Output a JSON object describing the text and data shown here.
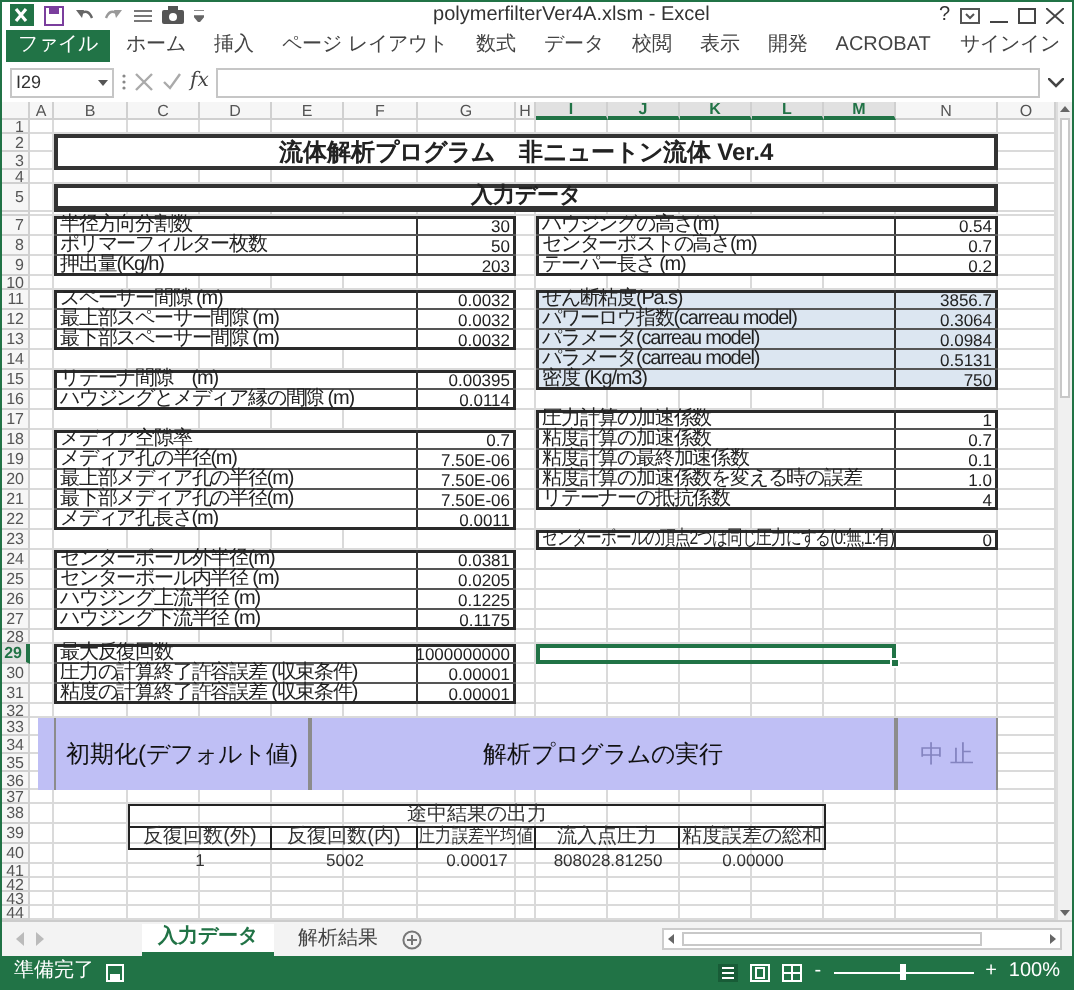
{
  "window": {
    "title": "polymerfilterVer4A.xlsm - Excel",
    "help": "?"
  },
  "ribbon_tabs": [
    {
      "label": "ファイル",
      "selected": true
    },
    {
      "label": "ホーム",
      "selected": false
    },
    {
      "label": "挿入",
      "selected": false
    },
    {
      "label": "ページ レイアウト",
      "selected": false
    },
    {
      "label": "数式",
      "selected": false
    },
    {
      "label": "データ",
      "selected": false
    },
    {
      "label": "校閲",
      "selected": false
    },
    {
      "label": "表示",
      "selected": false
    },
    {
      "label": "開発",
      "selected": false
    },
    {
      "label": "ACROBAT",
      "selected": false
    }
  ],
  "sign_in": "サインイン",
  "formula_bar": {
    "name_box": "I29",
    "function_label": "fx"
  },
  "columns": [
    {
      "label": "A",
      "selected": false
    },
    {
      "label": "B",
      "selected": false
    },
    {
      "label": "C",
      "selected": false
    },
    {
      "label": "D",
      "selected": false
    },
    {
      "label": "E",
      "selected": false
    },
    {
      "label": "F",
      "selected": false
    },
    {
      "label": "G",
      "selected": false
    },
    {
      "label": "H",
      "selected": false
    },
    {
      "label": "I",
      "selected": true
    },
    {
      "label": "J",
      "selected": true
    },
    {
      "label": "K",
      "selected": true
    },
    {
      "label": "L",
      "selected": true
    },
    {
      "label": "M",
      "selected": true
    },
    {
      "label": "N",
      "selected": false
    },
    {
      "label": "O",
      "selected": false
    }
  ],
  "rows": [
    {
      "label": "1",
      "selected": false
    },
    {
      "label": "2",
      "selected": false
    },
    {
      "label": "3",
      "selected": false
    },
    {
      "label": "4",
      "selected": false
    },
    {
      "label": "5",
      "selected": false
    },
    {
      "label": "7",
      "selected": false
    },
    {
      "label": "8",
      "selected": false
    },
    {
      "label": "9",
      "selected": false
    },
    {
      "label": "10",
      "selected": false
    },
    {
      "label": "11",
      "selected": false
    },
    {
      "label": "12",
      "selected": false
    },
    {
      "label": "13",
      "selected": false
    },
    {
      "label": "14",
      "selected": false
    },
    {
      "label": "15",
      "selected": false
    },
    {
      "label": "16",
      "selected": false
    },
    {
      "label": "17",
      "selected": false
    },
    {
      "label": "18",
      "selected": false
    },
    {
      "label": "19",
      "selected": false
    },
    {
      "label": "20",
      "selected": false
    },
    {
      "label": "21",
      "selected": false
    },
    {
      "label": "22",
      "selected": false
    },
    {
      "label": "23",
      "selected": false
    },
    {
      "label": "24",
      "selected": false
    },
    {
      "label": "25",
      "selected": false
    },
    {
      "label": "26",
      "selected": false
    },
    {
      "label": "27",
      "selected": false
    },
    {
      "label": "28",
      "selected": false
    },
    {
      "label": "29",
      "selected": true
    },
    {
      "label": "30",
      "selected": false
    },
    {
      "label": "31",
      "selected": false
    },
    {
      "label": "32",
      "selected": false
    },
    {
      "label": "33",
      "selected": false
    },
    {
      "label": "34",
      "selected": false
    },
    {
      "label": "35",
      "selected": false
    },
    {
      "label": "36",
      "selected": false
    },
    {
      "label": "37",
      "selected": false
    },
    {
      "label": "38",
      "selected": false
    },
    {
      "label": "39",
      "selected": false
    },
    {
      "label": "40",
      "selected": false
    },
    {
      "label": "41",
      "selected": false
    },
    {
      "label": "42",
      "selected": false
    },
    {
      "label": "43",
      "selected": false
    },
    {
      "label": "44",
      "selected": false
    }
  ],
  "sheet": {
    "title": "流体解析プログラム　非ニュートン流体 Ver.4",
    "section_title": "入力データ",
    "left_groups": [
      {
        "shaded": false,
        "items": [
          {
            "label": "半径方向分割数",
            "value": "30"
          },
          {
            "label": "ポリマーフィルター枚数",
            "value": "50"
          },
          {
            "label": "押出量(Kg/h)",
            "value": "203"
          }
        ]
      },
      {
        "shaded": false,
        "items": [
          {
            "label": "スペーサー間隙 (m)",
            "value": "0.0032"
          },
          {
            "label": "最上部スペーサー間隙 (m)",
            "value": "0.0032"
          },
          {
            "label": "最下部スペーサー間隙 (m)",
            "value": "0.0032"
          }
        ]
      },
      {
        "shaded": false,
        "items": [
          {
            "label": "リテーナ間隙　(m)",
            "value": "0.00395"
          },
          {
            "label": "ハウジングとメディア縁の間隙 (m)",
            "value": "0.0114"
          }
        ]
      },
      {
        "shaded": false,
        "items": [
          {
            "label": "メディア空隙率",
            "value": "0.7"
          },
          {
            "label": "メディア孔の半径(m)",
            "value": "7.50E-06"
          },
          {
            "label": "最上部メディア孔の半径(m)",
            "value": "7.50E-06"
          },
          {
            "label": "最下部メディア孔の半径(m)",
            "value": "7.50E-06"
          },
          {
            "label": "メディア孔長さ(m)",
            "value": "0.0011"
          }
        ]
      },
      {
        "shaded": false,
        "items": [
          {
            "label": "センターポール外半径(m)",
            "value": "0.0381"
          },
          {
            "label": "センターポール内半径 (m)",
            "value": "0.0205"
          },
          {
            "label": "ハウジング上流半径 (m)",
            "value": "0.1225"
          },
          {
            "label": "ハウジング下流半径 (m)",
            "value": "0.1175"
          }
        ]
      },
      {
        "shaded": false,
        "items": [
          {
            "label": "最大反復回数",
            "value": "1000000000"
          },
          {
            "label": "圧力の計算終了許容誤差 (収束条件)",
            "value": "0.00001"
          },
          {
            "label": "粘度の計算終了許容誤差 (収束条件)",
            "value": "0.00001"
          }
        ]
      }
    ],
    "right_groups": [
      {
        "shaded": false,
        "items": [
          {
            "label": "ハウジングの高さ(m)",
            "value": "0.54"
          },
          {
            "label": "センターポストの高さ(m)",
            "value": "0.7"
          },
          {
            "label": "テーパー長さ (m)",
            "value": "0.2"
          }
        ]
      },
      {
        "shaded": true,
        "items": [
          {
            "label": "せん断粘度(Pa.s)",
            "value": "3856.7"
          },
          {
            "label": "パワーロウ指数(carreau model)",
            "value": "0.3064"
          },
          {
            "label": "パラメータ(carreau model)",
            "value": "0.0984"
          },
          {
            "label": "パラメータ(carreau model)",
            "value": "0.5131"
          },
          {
            "label": "密度 (Kg/m3)",
            "value": "750"
          }
        ]
      },
      {
        "shaded": false,
        "items": [
          {
            "label": "圧力計算の加速係数",
            "value": "1"
          },
          {
            "label": "粘度計算の加速係数",
            "value": "0.7"
          },
          {
            "label": "粘度計算の最終加速係数",
            "value": "0.1"
          },
          {
            "label": "粘度計算の加速係数を変える時の誤差",
            "value": "1.0"
          },
          {
            "label": "リテーナーの抵抗係数",
            "value": "4"
          }
        ]
      },
      {
        "shaded": false,
        "items": [
          {
            "label": "センターポールの頂点2つは同じ圧力にする(0:無,1:有)",
            "value": "0"
          }
        ]
      }
    ],
    "buttons": [
      {
        "label": "初期化(デフォルト値)",
        "disabled": false
      },
      {
        "label": "解析プログラムの実行",
        "disabled": false
      },
      {
        "label": "中 止",
        "disabled": true
      }
    ],
    "results": {
      "title": "途中結果の出力",
      "headers": [
        "反復回数(外)",
        "反復回数(内)",
        "圧力誤差平均値",
        "流入点圧力",
        "粘度誤差の総和"
      ],
      "values": [
        "1",
        "5002",
        "0.00017",
        "808028.81250",
        "0.00000"
      ]
    }
  },
  "sheet_tabs": [
    {
      "label": "入力データ",
      "selected": true
    },
    {
      "label": "解析結果",
      "selected": false
    }
  ],
  "status_bar": {
    "status": "準備完了",
    "zoom_out": "-",
    "zoom_in": "+",
    "zoom": {
      "level": 0.5
    },
    "zoom_text": "100%"
  }
}
